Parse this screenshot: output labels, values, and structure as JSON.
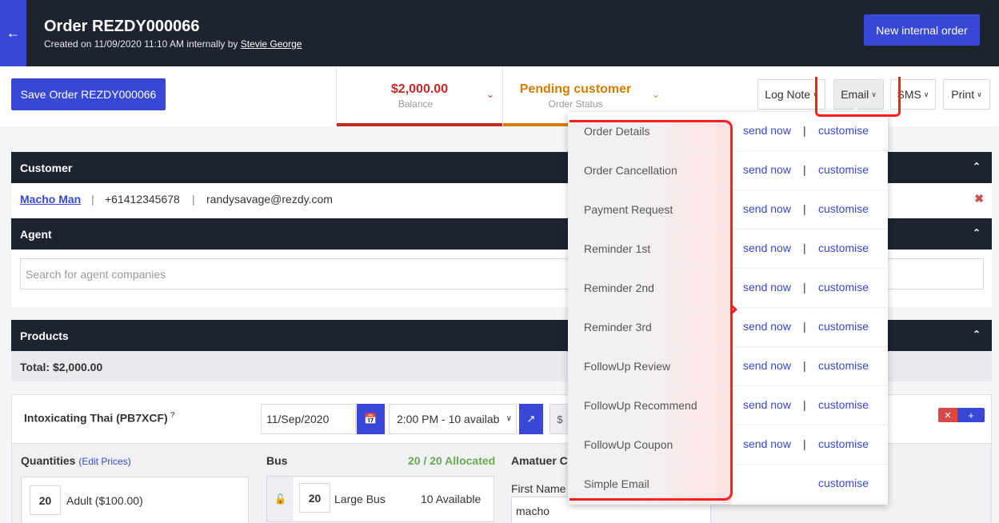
{
  "header": {
    "back_icon": "arrow-left-icon",
    "title": "Order REZDY000066",
    "subtitle_prefix": "Created on 11/09/2020 11:10 AM internally by",
    "created_by": "Stevie George",
    "new_order_label": "New internal order"
  },
  "actionbar": {
    "save_label": "Save Order REZDY000066",
    "balance_value": "$2,000.00",
    "balance_label": "Balance",
    "status_value": "Pending customer",
    "status_label": "Order Status",
    "log_note_label": "Log Note",
    "email_label": "Email",
    "sms_label": "SMS",
    "print_label": "Print",
    "balance_color": "#c62828",
    "status_color": "#d67d00"
  },
  "customer": {
    "section_title": "Customer",
    "name": "Macho Man",
    "phone": "+61412345678",
    "email": "randysavage@rezdy.com"
  },
  "agent": {
    "section_title": "Agent",
    "placeholder": "Search for agent companies"
  },
  "products": {
    "section_title": "Products",
    "total": "Total: $2,000.00",
    "item": {
      "name": "Intoxicating Thai (PB7XCF)",
      "help": "?",
      "date": "11/Sep/2020",
      "time": "2:00 PM - 10 availab",
      "currency": "$",
      "quantities_label": "Quantities",
      "edit_prices": "(Edit Prices)",
      "qty_value": "20",
      "qty_label": "Adult ($100.00)",
      "bus_label": "Bus",
      "bus_allocated": "20 / 20 Allocated",
      "bus_qty": "20",
      "bus_name": "Large Bus",
      "bus_available": "10 Available",
      "guest_label": "Amatuer Ch",
      "first_name_label": "First Name",
      "first_name_value": "macho"
    }
  },
  "email_menu": {
    "send_now": "send now",
    "separator": "|",
    "customise": "customise",
    "items": [
      "Order Details",
      "Order Cancellation",
      "Payment Request",
      "Reminder 1st",
      "Reminder 2nd",
      "Reminder 3rd",
      "FollowUp Review",
      "FollowUp Recommend",
      "FollowUp Coupon",
      "Simple Email"
    ]
  }
}
